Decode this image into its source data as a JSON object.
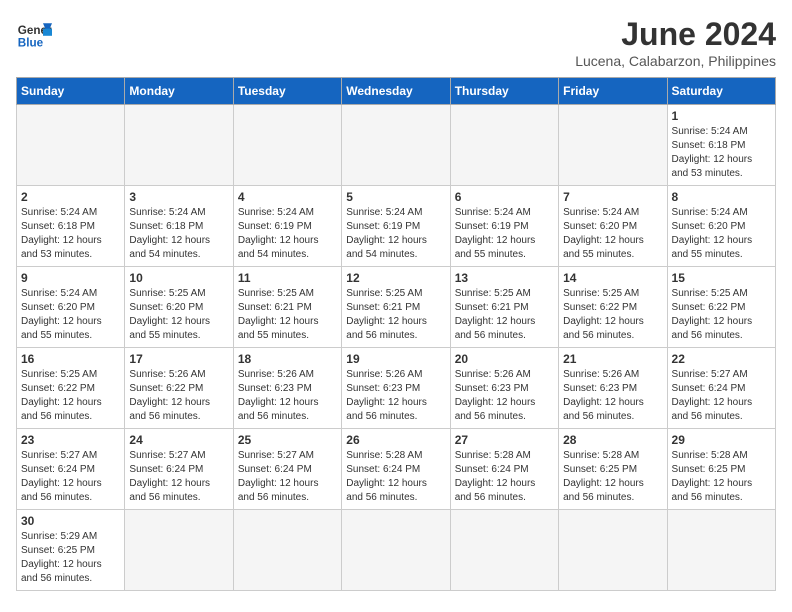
{
  "header": {
    "logo_general": "General",
    "logo_blue": "Blue",
    "month_title": "June 2024",
    "location": "Lucena, Calabarzon, Philippines"
  },
  "weekdays": [
    "Sunday",
    "Monday",
    "Tuesday",
    "Wednesday",
    "Thursday",
    "Friday",
    "Saturday"
  ],
  "weeks": [
    [
      {
        "day": "",
        "info": "",
        "empty": true
      },
      {
        "day": "",
        "info": "",
        "empty": true
      },
      {
        "day": "",
        "info": "",
        "empty": true
      },
      {
        "day": "",
        "info": "",
        "empty": true
      },
      {
        "day": "",
        "info": "",
        "empty": true
      },
      {
        "day": "",
        "info": "",
        "empty": true
      },
      {
        "day": "1",
        "info": "Sunrise: 5:24 AM\nSunset: 6:18 PM\nDaylight: 12 hours\nand 53 minutes.",
        "empty": false
      }
    ],
    [
      {
        "day": "2",
        "info": "Sunrise: 5:24 AM\nSunset: 6:18 PM\nDaylight: 12 hours\nand 53 minutes.",
        "empty": false
      },
      {
        "day": "3",
        "info": "Sunrise: 5:24 AM\nSunset: 6:18 PM\nDaylight: 12 hours\nand 54 minutes.",
        "empty": false
      },
      {
        "day": "4",
        "info": "Sunrise: 5:24 AM\nSunset: 6:19 PM\nDaylight: 12 hours\nand 54 minutes.",
        "empty": false
      },
      {
        "day": "5",
        "info": "Sunrise: 5:24 AM\nSunset: 6:19 PM\nDaylight: 12 hours\nand 54 minutes.",
        "empty": false
      },
      {
        "day": "6",
        "info": "Sunrise: 5:24 AM\nSunset: 6:19 PM\nDaylight: 12 hours\nand 55 minutes.",
        "empty": false
      },
      {
        "day": "7",
        "info": "Sunrise: 5:24 AM\nSunset: 6:20 PM\nDaylight: 12 hours\nand 55 minutes.",
        "empty": false
      },
      {
        "day": "8",
        "info": "Sunrise: 5:24 AM\nSunset: 6:20 PM\nDaylight: 12 hours\nand 55 minutes.",
        "empty": false
      }
    ],
    [
      {
        "day": "9",
        "info": "Sunrise: 5:24 AM\nSunset: 6:20 PM\nDaylight: 12 hours\nand 55 minutes.",
        "empty": false
      },
      {
        "day": "10",
        "info": "Sunrise: 5:25 AM\nSunset: 6:20 PM\nDaylight: 12 hours\nand 55 minutes.",
        "empty": false
      },
      {
        "day": "11",
        "info": "Sunrise: 5:25 AM\nSunset: 6:21 PM\nDaylight: 12 hours\nand 55 minutes.",
        "empty": false
      },
      {
        "day": "12",
        "info": "Sunrise: 5:25 AM\nSunset: 6:21 PM\nDaylight: 12 hours\nand 56 minutes.",
        "empty": false
      },
      {
        "day": "13",
        "info": "Sunrise: 5:25 AM\nSunset: 6:21 PM\nDaylight: 12 hours\nand 56 minutes.",
        "empty": false
      },
      {
        "day": "14",
        "info": "Sunrise: 5:25 AM\nSunset: 6:22 PM\nDaylight: 12 hours\nand 56 minutes.",
        "empty": false
      },
      {
        "day": "15",
        "info": "Sunrise: 5:25 AM\nSunset: 6:22 PM\nDaylight: 12 hours\nand 56 minutes.",
        "empty": false
      }
    ],
    [
      {
        "day": "16",
        "info": "Sunrise: 5:25 AM\nSunset: 6:22 PM\nDaylight: 12 hours\nand 56 minutes.",
        "empty": false
      },
      {
        "day": "17",
        "info": "Sunrise: 5:26 AM\nSunset: 6:22 PM\nDaylight: 12 hours\nand 56 minutes.",
        "empty": false
      },
      {
        "day": "18",
        "info": "Sunrise: 5:26 AM\nSunset: 6:23 PM\nDaylight: 12 hours\nand 56 minutes.",
        "empty": false
      },
      {
        "day": "19",
        "info": "Sunrise: 5:26 AM\nSunset: 6:23 PM\nDaylight: 12 hours\nand 56 minutes.",
        "empty": false
      },
      {
        "day": "20",
        "info": "Sunrise: 5:26 AM\nSunset: 6:23 PM\nDaylight: 12 hours\nand 56 minutes.",
        "empty": false
      },
      {
        "day": "21",
        "info": "Sunrise: 5:26 AM\nSunset: 6:23 PM\nDaylight: 12 hours\nand 56 minutes.",
        "empty": false
      },
      {
        "day": "22",
        "info": "Sunrise: 5:27 AM\nSunset: 6:24 PM\nDaylight: 12 hours\nand 56 minutes.",
        "empty": false
      }
    ],
    [
      {
        "day": "23",
        "info": "Sunrise: 5:27 AM\nSunset: 6:24 PM\nDaylight: 12 hours\nand 56 minutes.",
        "empty": false
      },
      {
        "day": "24",
        "info": "Sunrise: 5:27 AM\nSunset: 6:24 PM\nDaylight: 12 hours\nand 56 minutes.",
        "empty": false
      },
      {
        "day": "25",
        "info": "Sunrise: 5:27 AM\nSunset: 6:24 PM\nDaylight: 12 hours\nand 56 minutes.",
        "empty": false
      },
      {
        "day": "26",
        "info": "Sunrise: 5:28 AM\nSunset: 6:24 PM\nDaylight: 12 hours\nand 56 minutes.",
        "empty": false
      },
      {
        "day": "27",
        "info": "Sunrise: 5:28 AM\nSunset: 6:24 PM\nDaylight: 12 hours\nand 56 minutes.",
        "empty": false
      },
      {
        "day": "28",
        "info": "Sunrise: 5:28 AM\nSunset: 6:25 PM\nDaylight: 12 hours\nand 56 minutes.",
        "empty": false
      },
      {
        "day": "29",
        "info": "Sunrise: 5:28 AM\nSunset: 6:25 PM\nDaylight: 12 hours\nand 56 minutes.",
        "empty": false
      }
    ],
    [
      {
        "day": "30",
        "info": "Sunrise: 5:29 AM\nSunset: 6:25 PM\nDaylight: 12 hours\nand 56 minutes.",
        "empty": false
      },
      {
        "day": "",
        "info": "",
        "empty": true
      },
      {
        "day": "",
        "info": "",
        "empty": true
      },
      {
        "day": "",
        "info": "",
        "empty": true
      },
      {
        "day": "",
        "info": "",
        "empty": true
      },
      {
        "day": "",
        "info": "",
        "empty": true
      },
      {
        "day": "",
        "info": "",
        "empty": true
      }
    ]
  ]
}
